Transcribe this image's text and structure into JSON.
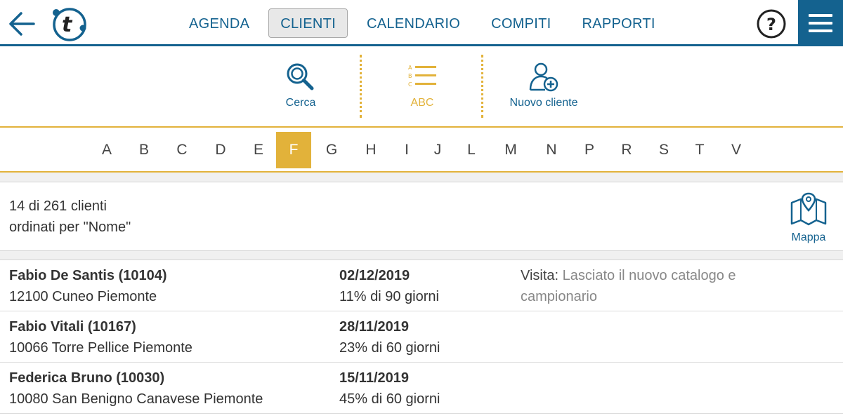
{
  "nav": {
    "items": [
      {
        "label": "AGENDA",
        "active": false
      },
      {
        "label": "CLIENTI",
        "active": true
      },
      {
        "label": "CALENDARIO",
        "active": false
      },
      {
        "label": "COMPITI",
        "active": false
      },
      {
        "label": "RAPPORTI",
        "active": false
      }
    ],
    "help_label": "?",
    "icons": [
      "arrow-left-icon",
      "app-logo",
      "help-icon",
      "hamburger-menu-icon"
    ]
  },
  "toolbar": {
    "search_label": "Cerca",
    "abc_label": "ABC",
    "new_client_label": "Nuovo cliente",
    "abc_icon_letters": [
      "A",
      "B",
      "C"
    ]
  },
  "alphabet": {
    "letters": [
      "A",
      "B",
      "C",
      "D",
      "E",
      "F",
      "G",
      "H",
      "I",
      "J",
      "L",
      "M",
      "N",
      "P",
      "R",
      "S",
      "T",
      "V"
    ],
    "active": "F"
  },
  "summary": {
    "count_line": "14 di 261 clienti",
    "order_line": "ordinati per \"Nome\"",
    "map_label": "Mappa"
  },
  "clients": [
    {
      "name": "Fabio De Santis (10104)",
      "address": "12100 Cuneo Piemonte",
      "date": "02/12/2019",
      "percent": "11% di 90 giorni",
      "note_label": "Visita:",
      "note_line1": "Lasciato il nuovo catalogo e",
      "note_line2": "campionario"
    },
    {
      "name": "Fabio Vitali (10167)",
      "address": "10066 Torre Pellice Piemonte",
      "date": "28/11/2019",
      "percent": "23% di 60 giorni"
    },
    {
      "name": "Federica Bruno (10030)",
      "address": "10080 San Benigno Canavese Piemonte",
      "date": "15/11/2019",
      "percent": "45% di 60 giorni"
    }
  ],
  "colors": {
    "primary": "#14628f",
    "accent": "#e2b23a",
    "text": "#333333",
    "muted": "#888888"
  }
}
